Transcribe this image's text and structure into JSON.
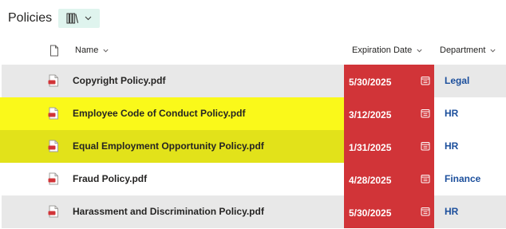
{
  "header": {
    "title": "Policies",
    "view_icon": "library-books-icon",
    "view_chevron": "chevron-down-icon"
  },
  "columns": {
    "file_type_icon": "document-icon",
    "name": "Name",
    "expiration_date": "Expiration Date",
    "department": "Department"
  },
  "colors": {
    "expired_cell": "#d13438",
    "department_link": "#1c4f9c",
    "highlight_yellow": "#faf91a",
    "highlight_olive": "#e2e21a",
    "row_gray": "#e8e8e8",
    "view_switch_bg": "#dff4ee"
  },
  "rows": [
    {
      "name": "Copyright Policy.pdf",
      "expiration": "5/30/2025",
      "department": "Legal",
      "highlight": "gray"
    },
    {
      "name": "Employee Code of Conduct Policy.pdf",
      "expiration": "3/12/2025",
      "department": "HR",
      "highlight": "yellow"
    },
    {
      "name": "Equal Employment Opportunity Policy.pdf",
      "expiration": "1/31/2025",
      "department": "HR",
      "highlight": "olive"
    },
    {
      "name": "Fraud Policy.pdf",
      "expiration": "4/28/2025",
      "department": "Finance",
      "highlight": "none"
    },
    {
      "name": "Harassment and Discrimination Policy.pdf",
      "expiration": "5/30/2025",
      "department": "HR",
      "highlight": "gray"
    }
  ]
}
